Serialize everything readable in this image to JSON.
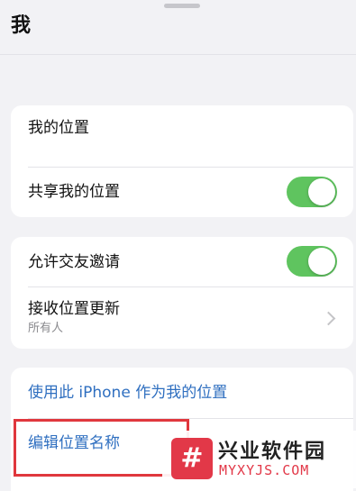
{
  "header": {
    "title": "我"
  },
  "location_card": {
    "my_location_label": "我的位置",
    "share_location_label": "共享我的位置",
    "share_toggle_on": true
  },
  "friends_card": {
    "allow_invites_label": "允许交友邀请",
    "allow_invites_on": true,
    "receive_updates_label": "接收位置更新",
    "receive_updates_value": "所有人"
  },
  "actions_card": {
    "use_iphone_label": "使用此 iPhone 作为我的位置",
    "edit_name_label": "编辑位置名称"
  },
  "watermark": {
    "logo_glyph": "#",
    "title": "兴业软件园",
    "url": "MYXYJS.COM"
  },
  "colors": {
    "toggle_on": "#5fc45f",
    "link": "#2f6fc0",
    "highlight": "#e0373d",
    "watermark_brand": "#e23848"
  }
}
